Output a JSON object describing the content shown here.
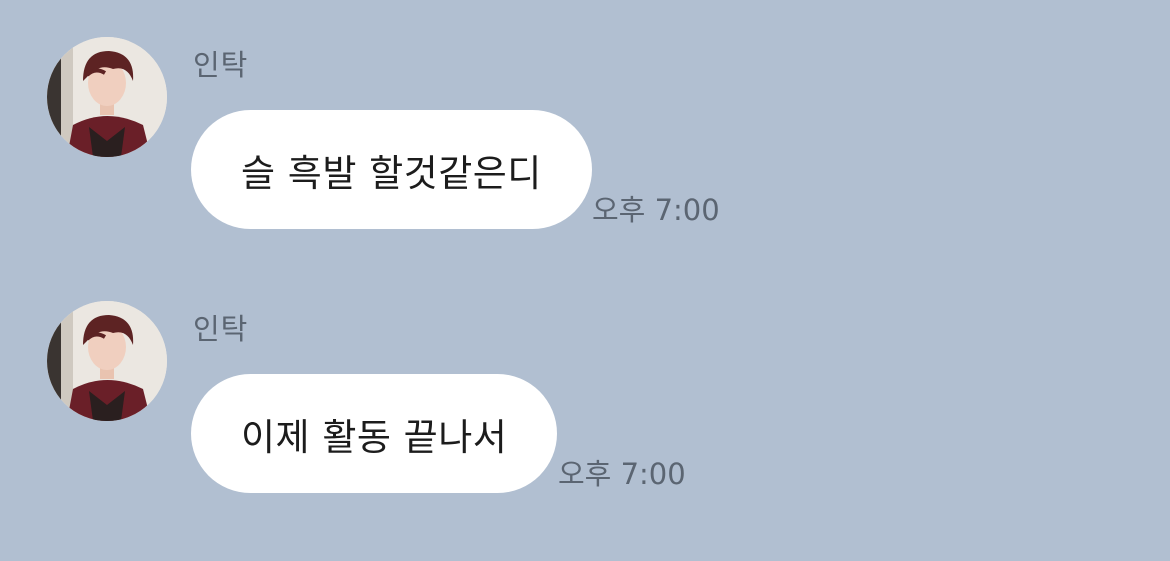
{
  "messages": [
    {
      "sender": "인탁",
      "avatar_icon": "profile-photo-icon",
      "text": "슬 흑발 할것같은디",
      "time": "오후 7:00"
    },
    {
      "sender": "인탁",
      "avatar_icon": "profile-photo-icon",
      "text": "이제 활동 끝나서",
      "time": "오후 7:00"
    }
  ],
  "colors": {
    "background": "#b1bfd1",
    "bubble": "#ffffff",
    "meta_text": "#5b6572",
    "message_text": "#1c1c1c"
  }
}
